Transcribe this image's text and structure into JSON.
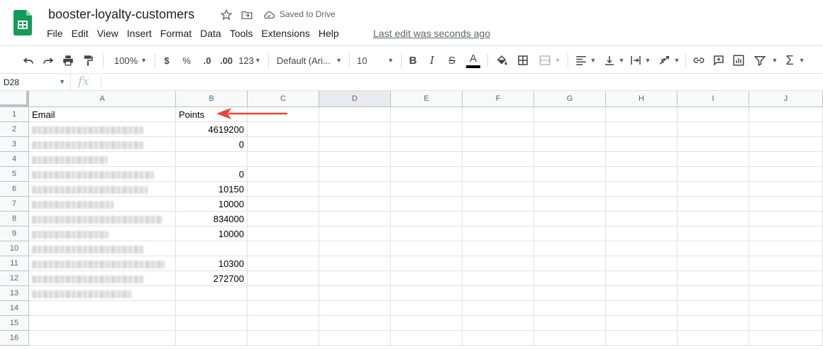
{
  "document": {
    "title": "booster-loyalty-customers",
    "saved_status": "Saved to Drive",
    "last_edit": "Last edit was seconds ago"
  },
  "menu": [
    "File",
    "Edit",
    "View",
    "Insert",
    "Format",
    "Data",
    "Tools",
    "Extensions",
    "Help"
  ],
  "toolbar": {
    "zoom": "100%",
    "currency": "$",
    "percent": "%",
    "decrease_decimal": ".0",
    "increase_decimal": ".00",
    "more_formats": "123",
    "font": "Default (Ari...",
    "font_size": "10",
    "bold": "B",
    "italic": "I",
    "strikethrough": "S",
    "text_color": "A",
    "sum": "Σ"
  },
  "formula_bar": {
    "name_box": "D28",
    "fx_label": "fx",
    "value": ""
  },
  "sheet": {
    "columns": [
      "A",
      "B",
      "C",
      "D",
      "E",
      "F",
      "G",
      "H",
      "I",
      "J"
    ],
    "active_column": "D",
    "rows": [
      "1",
      "2",
      "3",
      "4",
      "5",
      "6",
      "7",
      "8",
      "9",
      "10",
      "11",
      "12",
      "13",
      "14",
      "15",
      "16"
    ],
    "header": {
      "email": "Email",
      "points": "Points"
    },
    "points": [
      "4619200",
      "0",
      "",
      "0",
      "10150",
      "10000",
      "834000",
      "10000",
      "",
      "10300",
      "272700"
    ],
    "emails_redacted": true
  },
  "colors": {
    "arrow": "#ea4335",
    "logo_green": "#0f9d58",
    "header_bg": "#f8f9fa"
  },
  "icons": [
    "sheets-logo",
    "star-icon",
    "move-folder-icon",
    "cloud-saved-icon",
    "undo-icon",
    "redo-icon",
    "print-icon",
    "paint-format-icon",
    "fill-color-icon",
    "borders-icon",
    "merge-cells-icon",
    "align-left-icon",
    "vertical-align-icon",
    "text-wrap-icon",
    "text-rotation-icon",
    "link-icon",
    "comment-icon",
    "chart-icon",
    "filter-icon"
  ]
}
